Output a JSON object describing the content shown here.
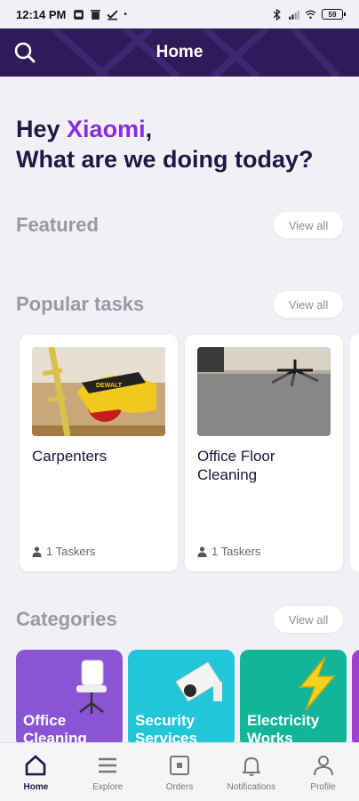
{
  "status_bar": {
    "time": "12:14 PM",
    "battery": "59"
  },
  "app_bar": {
    "title": "Home"
  },
  "greeting": {
    "prefix": "Hey ",
    "name": "Xiaomi",
    "suffix": ",",
    "line2": "What are we doing today?"
  },
  "featured": {
    "title": "Featured",
    "view_all": "View all"
  },
  "popular": {
    "title": "Popular tasks",
    "view_all": "View all",
    "tasks": [
      {
        "name": "Carpenters",
        "taskers": "1 Taskers"
      },
      {
        "name": "Office Floor Cleaning",
        "taskers": "1 Taskers"
      }
    ]
  },
  "categories": {
    "title": "Categories",
    "view_all": "View all",
    "items": [
      {
        "label": "Office Cleaning",
        "color": "#8a55d4"
      },
      {
        "label": "Security Services",
        "color": "#22c6d8"
      },
      {
        "label": "Electricity Works",
        "color": "#12b59a"
      }
    ]
  },
  "bottom_nav": {
    "items": [
      {
        "label": "Home",
        "icon": "home-icon"
      },
      {
        "label": "Explore",
        "icon": "menu-icon"
      },
      {
        "label": "Orders",
        "icon": "orders-icon"
      },
      {
        "label": "Notifications",
        "icon": "bell-icon"
      },
      {
        "label": "Profile",
        "icon": "profile-icon"
      }
    ]
  },
  "colors": {
    "app_bar": "#2f1a5a",
    "accent": "#8a2be2",
    "background": "#f1f0f4"
  }
}
